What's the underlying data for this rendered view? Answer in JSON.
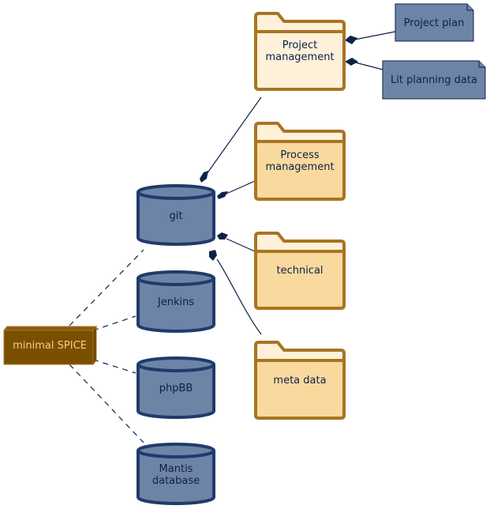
{
  "node": {
    "label": "minimal SPICE"
  },
  "databases": [
    {
      "label": "git"
    },
    {
      "label": "Jenkins"
    },
    {
      "label": "phpBB"
    },
    {
      "label_line1": "Mantis",
      "label_line2": "database"
    }
  ],
  "folders": [
    {
      "label_line1": "Project",
      "label_line2": "management"
    },
    {
      "label_line1": "Process",
      "label_line2": "management"
    },
    {
      "label": "technical"
    },
    {
      "label": "meta data"
    }
  ],
  "notes": [
    {
      "label": "Project plan"
    },
    {
      "label": "Lit planning data"
    }
  ],
  "colors": {
    "node": "#7a4f00",
    "database": "#6e84a6",
    "folder_light": "#fff0d9",
    "folder": "#fad99e",
    "border": "#a87522"
  }
}
